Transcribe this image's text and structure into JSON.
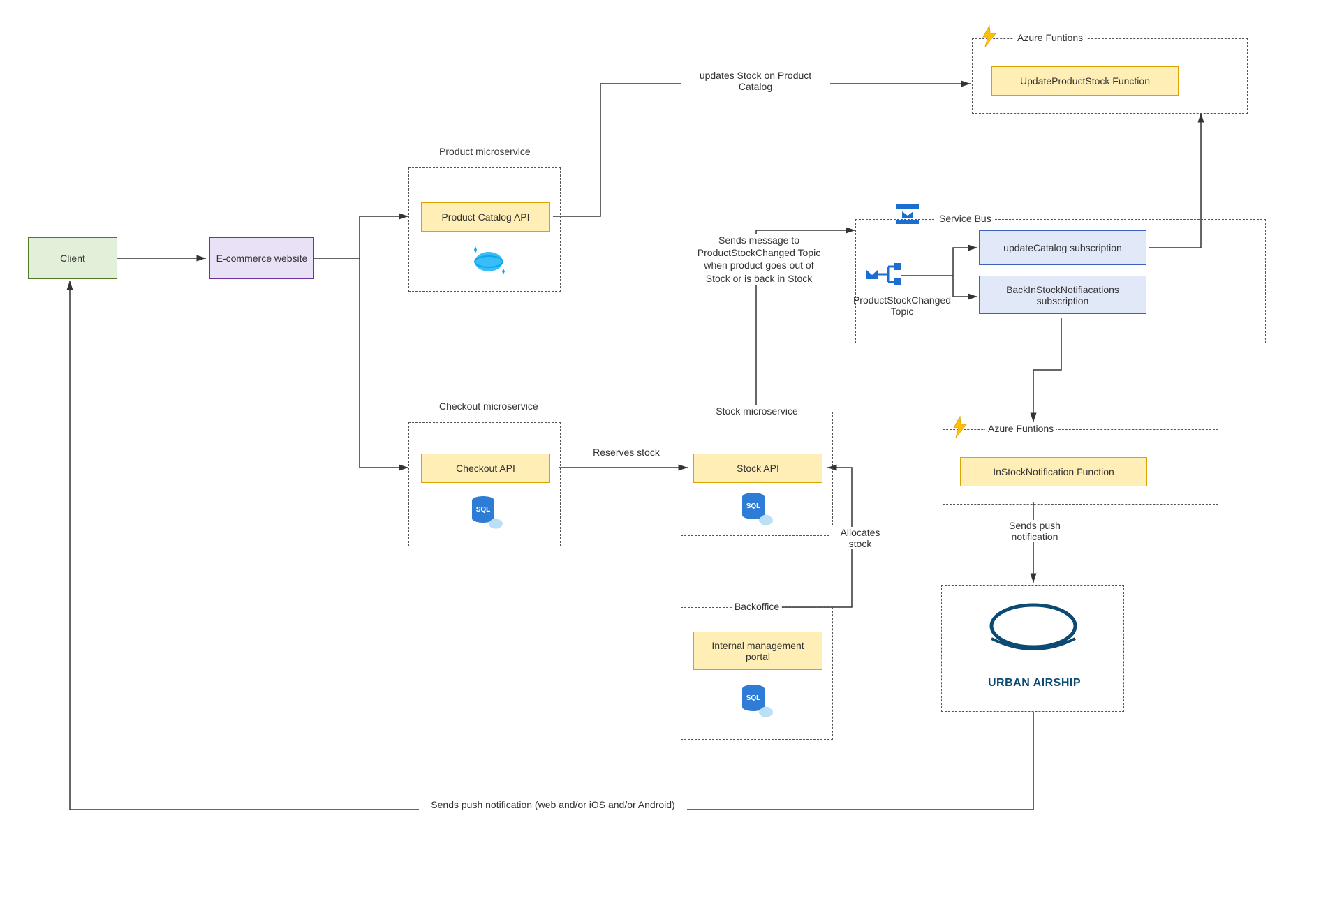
{
  "nodes": {
    "client": "Client",
    "ecommerce": "E-commerce website",
    "productCatalogApi": "Product Catalog API",
    "checkoutApi": "Checkout API",
    "stockApi": "Stock API",
    "internalPortal": "Internal management portal",
    "updateProductStockFn": "UpdateProductStock Function",
    "inStockNotificationFn": "InStockNotification Function",
    "updateCatalogSub": "updateCatalog subscription",
    "backInStockSub": "BackInStockNotifiacations subscription",
    "productStockChangedTopic": "ProductStockChanged Topic",
    "urbanAirship": "URBAN AIRSHIP"
  },
  "groups": {
    "product": "Product microservice",
    "checkout": "Checkout microservice",
    "stock": "Stock microservice",
    "backoffice": "Backoffice",
    "serviceBus": "Service Bus",
    "azureFn1": "Azure Funtions",
    "azureFn2": "Azure Funtions"
  },
  "edges": {
    "updatesStock": "updates Stock on Product Catalog",
    "reservesStock": "Reserves stock",
    "allocatesStock": "Allocates stock",
    "sendsMessage": "Sends message to ProductStockChanged Topic when product goes out of Stock or is back in Stock",
    "sendsPush": "Sends push notification",
    "sendsPushWeb": "Sends push notification (web and/or iOS and/or Android)"
  }
}
